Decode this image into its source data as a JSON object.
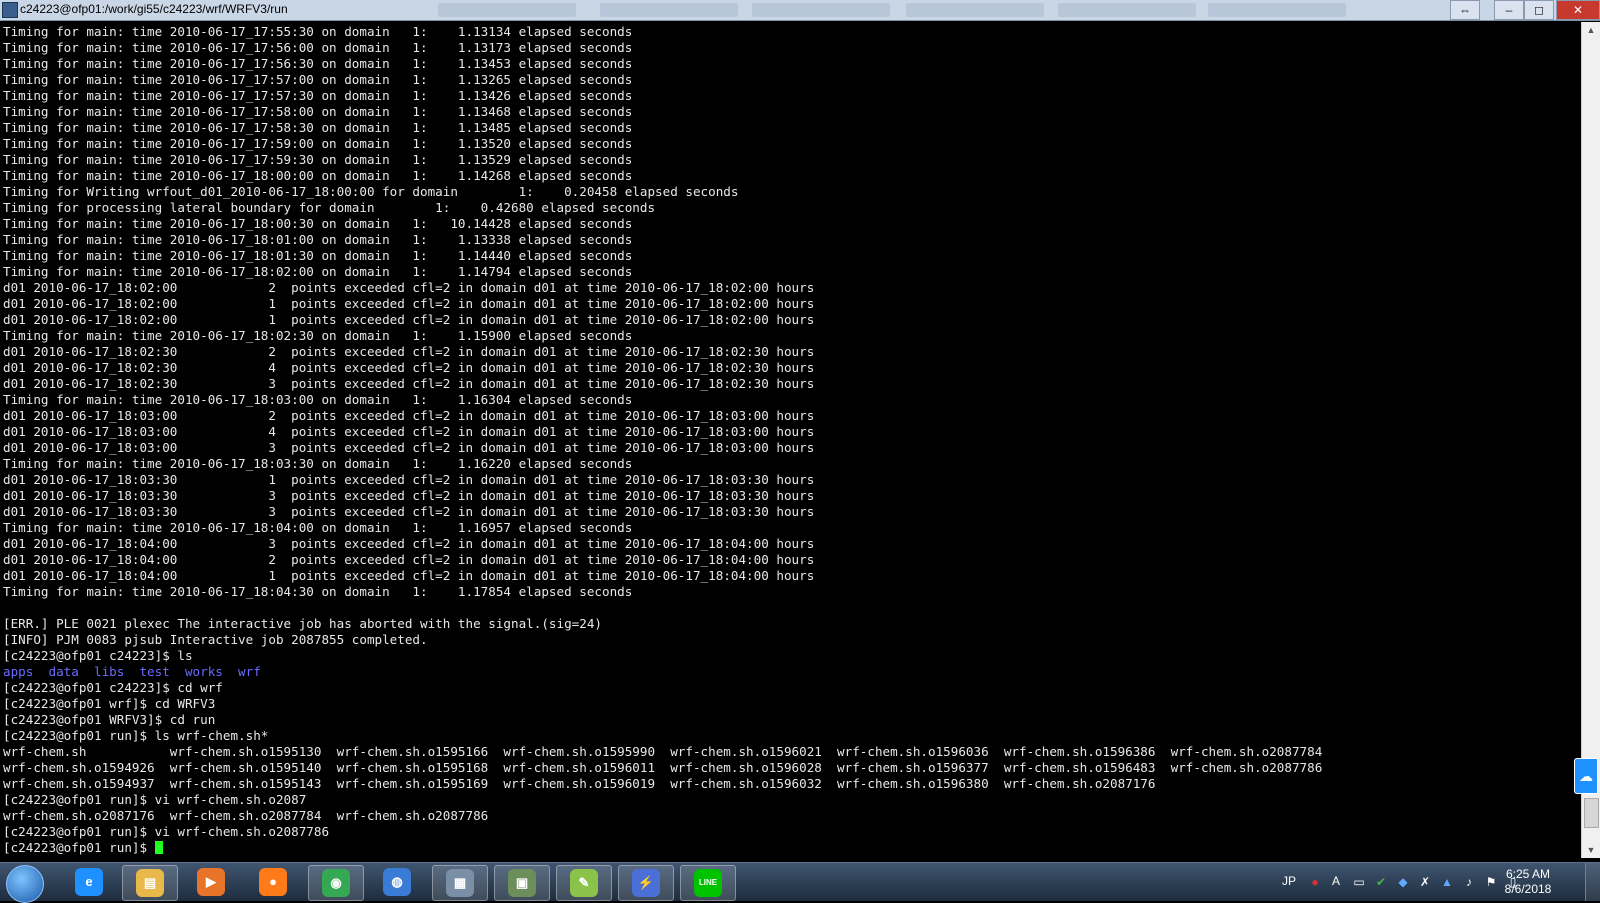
{
  "window": {
    "title": "c24223@ofp01:/work/gi55/c24223/wrf/WRFV3/run",
    "minimize": "–",
    "maximize": "◻",
    "close": "✕",
    "restore": "⇔"
  },
  "terminal": {
    "lines": [
      {
        "text": "Timing for main: time 2010-06-17_17:55:30 on domain   1:    1.13134 elapsed seconds"
      },
      {
        "text": "Timing for main: time 2010-06-17_17:56:00 on domain   1:    1.13173 elapsed seconds"
      },
      {
        "text": "Timing for main: time 2010-06-17_17:56:30 on domain   1:    1.13453 elapsed seconds"
      },
      {
        "text": "Timing for main: time 2010-06-17_17:57:00 on domain   1:    1.13265 elapsed seconds"
      },
      {
        "text": "Timing for main: time 2010-06-17_17:57:30 on domain   1:    1.13426 elapsed seconds"
      },
      {
        "text": "Timing for main: time 2010-06-17_17:58:00 on domain   1:    1.13468 elapsed seconds"
      },
      {
        "text": "Timing for main: time 2010-06-17_17:58:30 on domain   1:    1.13485 elapsed seconds"
      },
      {
        "text": "Timing for main: time 2010-06-17_17:59:00 on domain   1:    1.13520 elapsed seconds"
      },
      {
        "text": "Timing for main: time 2010-06-17_17:59:30 on domain   1:    1.13529 elapsed seconds"
      },
      {
        "text": "Timing for main: time 2010-06-17_18:00:00 on domain   1:    1.14268 elapsed seconds"
      },
      {
        "text": "Timing for Writing wrfout_d01_2010-06-17_18:00:00 for domain        1:    0.20458 elapsed seconds"
      },
      {
        "text": "Timing for processing lateral boundary for domain        1:    0.42680 elapsed seconds"
      },
      {
        "text": "Timing for main: time 2010-06-17_18:00:30 on domain   1:   10.14428 elapsed seconds"
      },
      {
        "text": "Timing for main: time 2010-06-17_18:01:00 on domain   1:    1.13338 elapsed seconds"
      },
      {
        "text": "Timing for main: time 2010-06-17_18:01:30 on domain   1:    1.14440 elapsed seconds"
      },
      {
        "text": "Timing for main: time 2010-06-17_18:02:00 on domain   1:    1.14794 elapsed seconds"
      },
      {
        "text": "d01 2010-06-17_18:02:00            2  points exceeded cfl=2 in domain d01 at time 2010-06-17_18:02:00 hours"
      },
      {
        "text": "d01 2010-06-17_18:02:00            1  points exceeded cfl=2 in domain d01 at time 2010-06-17_18:02:00 hours"
      },
      {
        "text": "d01 2010-06-17_18:02:00            1  points exceeded cfl=2 in domain d01 at time 2010-06-17_18:02:00 hours"
      },
      {
        "text": "Timing for main: time 2010-06-17_18:02:30 on domain   1:    1.15900 elapsed seconds"
      },
      {
        "text": "d01 2010-06-17_18:02:30            2  points exceeded cfl=2 in domain d01 at time 2010-06-17_18:02:30 hours"
      },
      {
        "text": "d01 2010-06-17_18:02:30            4  points exceeded cfl=2 in domain d01 at time 2010-06-17_18:02:30 hours"
      },
      {
        "text": "d01 2010-06-17_18:02:30            3  points exceeded cfl=2 in domain d01 at time 2010-06-17_18:02:30 hours"
      },
      {
        "text": "Timing for main: time 2010-06-17_18:03:00 on domain   1:    1.16304 elapsed seconds"
      },
      {
        "text": "d01 2010-06-17_18:03:00            2  points exceeded cfl=2 in domain d01 at time 2010-06-17_18:03:00 hours"
      },
      {
        "text": "d01 2010-06-17_18:03:00            4  points exceeded cfl=2 in domain d01 at time 2010-06-17_18:03:00 hours"
      },
      {
        "text": "d01 2010-06-17_18:03:00            3  points exceeded cfl=2 in domain d01 at time 2010-06-17_18:03:00 hours"
      },
      {
        "text": "Timing for main: time 2010-06-17_18:03:30 on domain   1:    1.16220 elapsed seconds"
      },
      {
        "text": "d01 2010-06-17_18:03:30            1  points exceeded cfl=2 in domain d01 at time 2010-06-17_18:03:30 hours"
      },
      {
        "text": "d01 2010-06-17_18:03:30            3  points exceeded cfl=2 in domain d01 at time 2010-06-17_18:03:30 hours"
      },
      {
        "text": "d01 2010-06-17_18:03:30            3  points exceeded cfl=2 in domain d01 at time 2010-06-17_18:03:30 hours"
      },
      {
        "text": "Timing for main: time 2010-06-17_18:04:00 on domain   1:    1.16957 elapsed seconds"
      },
      {
        "text": "d01 2010-06-17_18:04:00            3  points exceeded cfl=2 in domain d01 at time 2010-06-17_18:04:00 hours"
      },
      {
        "text": "d01 2010-06-17_18:04:00            2  points exceeded cfl=2 in domain d01 at time 2010-06-17_18:04:00 hours"
      },
      {
        "text": "d01 2010-06-17_18:04:00            1  points exceeded cfl=2 in domain d01 at time 2010-06-17_18:04:00 hours"
      },
      {
        "text": "Timing for main: time 2010-06-17_18:04:30 on domain   1:    1.17854 elapsed seconds"
      },
      {
        "text": ""
      },
      {
        "text": "[ERR.] PLE 0021 plexec The interactive job has aborted with the signal.(sig=24)"
      },
      {
        "text": "[INFO] PJM 0083 pjsub Interactive job 2087855 completed."
      },
      {
        "text": "[c24223@ofp01 c24223]$ ls"
      },
      {
        "text": "apps  data  libs  test  works  wrf",
        "style": "dir"
      },
      {
        "text": "[c24223@ofp01 c24223]$ cd wrf"
      },
      {
        "text": "[c24223@ofp01 wrf]$ cd WRFV3"
      },
      {
        "text": "[c24223@ofp01 WRFV3]$ cd run"
      },
      {
        "text": "[c24223@ofp01 run]$ ls wrf-chem.sh*"
      },
      {
        "text": "wrf-chem.sh           wrf-chem.sh.o1595130  wrf-chem.sh.o1595166  wrf-chem.sh.o1595990  wrf-chem.sh.o1596021  wrf-chem.sh.o1596036  wrf-chem.sh.o1596386  wrf-chem.sh.o2087784"
      },
      {
        "text": "wrf-chem.sh.o1594926  wrf-chem.sh.o1595140  wrf-chem.sh.o1595168  wrf-chem.sh.o1596011  wrf-chem.sh.o1596028  wrf-chem.sh.o1596377  wrf-chem.sh.o1596483  wrf-chem.sh.o2087786"
      },
      {
        "text": "wrf-chem.sh.o1594937  wrf-chem.sh.o1595143  wrf-chem.sh.o1595169  wrf-chem.sh.o1596019  wrf-chem.sh.o1596032  wrf-chem.sh.o1596380  wrf-chem.sh.o2087176"
      },
      {
        "text": "[c24223@ofp01 run]$ vi wrf-chem.sh.o2087"
      },
      {
        "text": "wrf-chem.sh.o2087176  wrf-chem.sh.o2087784  wrf-chem.sh.o2087786"
      },
      {
        "text": "[c24223@ofp01 run]$ vi wrf-chem.sh.o2087786"
      }
    ],
    "prompt": "[c24223@ofp01 run]$ "
  },
  "taskbar": {
    "apps": [
      {
        "name": "internet-explorer-icon",
        "glyph": "e",
        "color": "#1e90ff",
        "framed": false
      },
      {
        "name": "file-explorer-icon",
        "glyph": "▤",
        "color": "#e8b84a",
        "framed": true
      },
      {
        "name": "media-player-icon",
        "glyph": "▶",
        "color": "#e8742a",
        "framed": false
      },
      {
        "name": "firefox-icon",
        "glyph": "●",
        "color": "#ff7b1a",
        "framed": false
      },
      {
        "name": "chrome-icon",
        "glyph": "◉",
        "color": "#34a853",
        "framed": true
      },
      {
        "name": "globe-icon",
        "glyph": "◍",
        "color": "#3a7bd5",
        "framed": false
      },
      {
        "name": "calculator-icon",
        "glyph": "▦",
        "color": "#7a8ea6",
        "framed": true
      },
      {
        "name": "remote-desktop-icon",
        "glyph": "▣",
        "color": "#6b8e5a",
        "framed": true
      },
      {
        "name": "notepad-icon",
        "glyph": "✎",
        "color": "#8bc34a",
        "framed": true
      },
      {
        "name": "putty-icon",
        "glyph": "⚡",
        "color": "#4a6fd6",
        "framed": true
      },
      {
        "name": "line-icon",
        "glyph": "LINE",
        "color": "#00c300",
        "framed": true
      }
    ],
    "tray": {
      "lang": "JP",
      "ime": "A"
    },
    "clock": {
      "time": "6:25 AM",
      "date": "8/6/2018"
    }
  }
}
